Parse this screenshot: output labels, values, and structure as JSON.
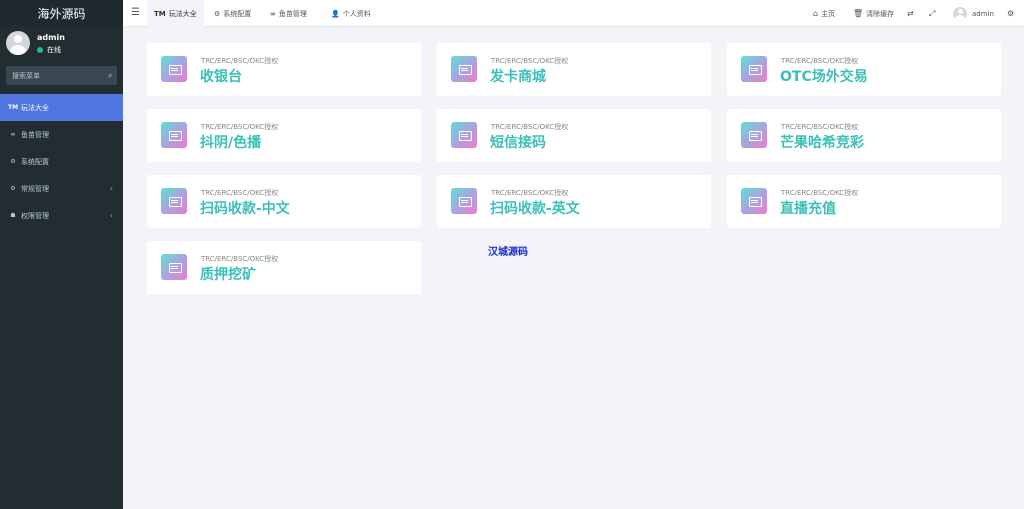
{
  "sidebar": {
    "logo": "海外源码",
    "user": {
      "name": "admin",
      "status": "在线"
    },
    "search_placeholder": "搜索菜单",
    "menu": [
      {
        "icon": "TM",
        "label": "玩法大全",
        "active": true
      },
      {
        "icon": "∞",
        "label": "鱼苗管理"
      },
      {
        "icon": "⚙",
        "label": "系统配置"
      },
      {
        "icon": "⚙",
        "label": "常规管理",
        "arrow": "‹"
      },
      {
        "icon": "☗",
        "label": "权限管理",
        "arrow": "‹"
      }
    ]
  },
  "topbar": {
    "tabs": [
      {
        "icon": "TM",
        "label": "玩法大全"
      },
      {
        "icon": "⚙",
        "label": "系统配置"
      },
      {
        "icon": "∞",
        "label": "鱼苗管理"
      },
      {
        "icon": "👤",
        "label": "个人资料"
      }
    ],
    "home": "主页",
    "clear_cache": "清除缓存",
    "user_name": "admin"
  },
  "cards": [
    {
      "subtitle": "TRC/ERC/BSC/OKC授权",
      "title": "收银台"
    },
    {
      "subtitle": "TRC/ERC/BSC/OKC授权",
      "title": "发卡商城"
    },
    {
      "subtitle": "TRC/ERC/BSC/OKC授权",
      "title": "OTC场外交易"
    },
    {
      "subtitle": "TRC/ERC/BSC/OKC授权",
      "title": "抖阴/色播"
    },
    {
      "subtitle": "TRC/ERC/BSC/OKC授权",
      "title": "短信接码"
    },
    {
      "subtitle": "TRC/ERC/BSC/OKC授权",
      "title": "芒果哈希竞彩"
    },
    {
      "subtitle": "TRC/ERC/BSC/OKC授权",
      "title": "扫码收款-中文"
    },
    {
      "subtitle": "TRC/ERC/BSC/OKC授权",
      "title": "扫码收款-英文"
    },
    {
      "subtitle": "TRC/ERC/BSC/OKC授权",
      "title": "直播充值"
    },
    {
      "subtitle": "TRC/ERC/BSC/OKC授权",
      "title": "质押挖矿"
    }
  ],
  "watermark": "汉城源码",
  "colors": {
    "sidebar_bg": "#222d32",
    "active_menu": "#4e75e0",
    "card_title": "#3bc0b8",
    "watermark": "#1a2bd1"
  }
}
